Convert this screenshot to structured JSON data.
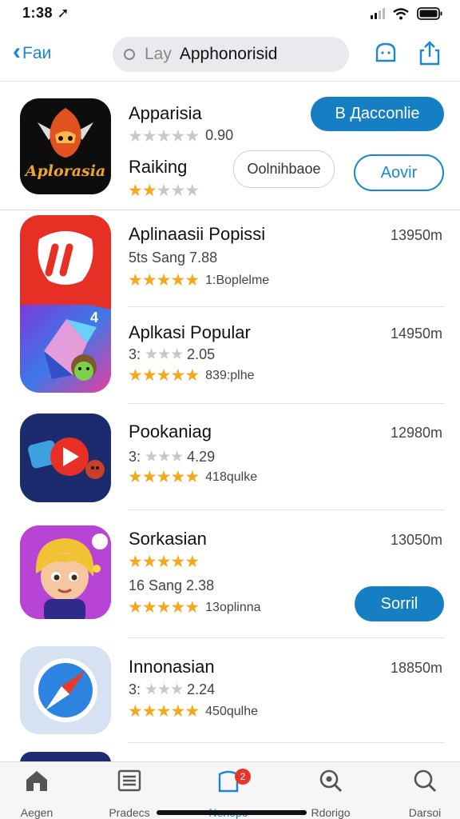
{
  "status_bar": {
    "time": "1:38"
  },
  "nav": {
    "back_label": "Faи",
    "search_placeholder": "Lay",
    "search_query": "Apphonorisid"
  },
  "featured": {
    "icon_label": "Aplorasia",
    "title": "Apparisia",
    "rating_text": "0.90",
    "rating": 0,
    "primary_button": "В Дассоnlie",
    "ranking_label": "Raiking",
    "ranking_rating": 2,
    "secondary_field": "Oolnihbaoe",
    "outline_button": "Aovir"
  },
  "apps": [
    {
      "title": "Aplinaasii Popissi",
      "subtitle": "5ts Sang 7.88",
      "size": "13950m",
      "rating": 4.5,
      "count": "1:Boplelme"
    },
    {
      "title": "Aplkasi Popular",
      "subtitle": "3: 2.05",
      "subtitle_stars": 3,
      "size": "14950m",
      "rating": 4.5,
      "count": "839:plhe",
      "badge_num": "4"
    },
    {
      "title": "Pookaniag",
      "subtitle": "3: 4.29",
      "subtitle_stars": 3,
      "size": "12980m",
      "rating": 4.5,
      "count": "418qulke"
    },
    {
      "title": "Sorkasian",
      "subtitle": "16 Sang 2.38",
      "size": "13050m",
      "rating": 4.5,
      "count": "13oplinna",
      "title_stars": 5,
      "button": "Sorril"
    },
    {
      "title": "Innonasian",
      "subtitle": "3: 2.24",
      "subtitle_stars": 3,
      "size": "18850m",
      "rating": 4.5,
      "count": "450qulhe"
    }
  ],
  "tabs": [
    {
      "label": "Aegen",
      "icon": "home-icon"
    },
    {
      "label": "Pradecs",
      "icon": "list-icon"
    },
    {
      "label": "Nenepo",
      "icon": "cart-icon",
      "badge": "2",
      "active": true
    },
    {
      "label": "Rdorigo",
      "icon": "search-icon"
    },
    {
      "label": "Darsoi",
      "icon": "search-icon"
    }
  ],
  "colors": {
    "accent": "#1b86d6",
    "star": "#f5a81c",
    "badge": "#e8352b"
  }
}
